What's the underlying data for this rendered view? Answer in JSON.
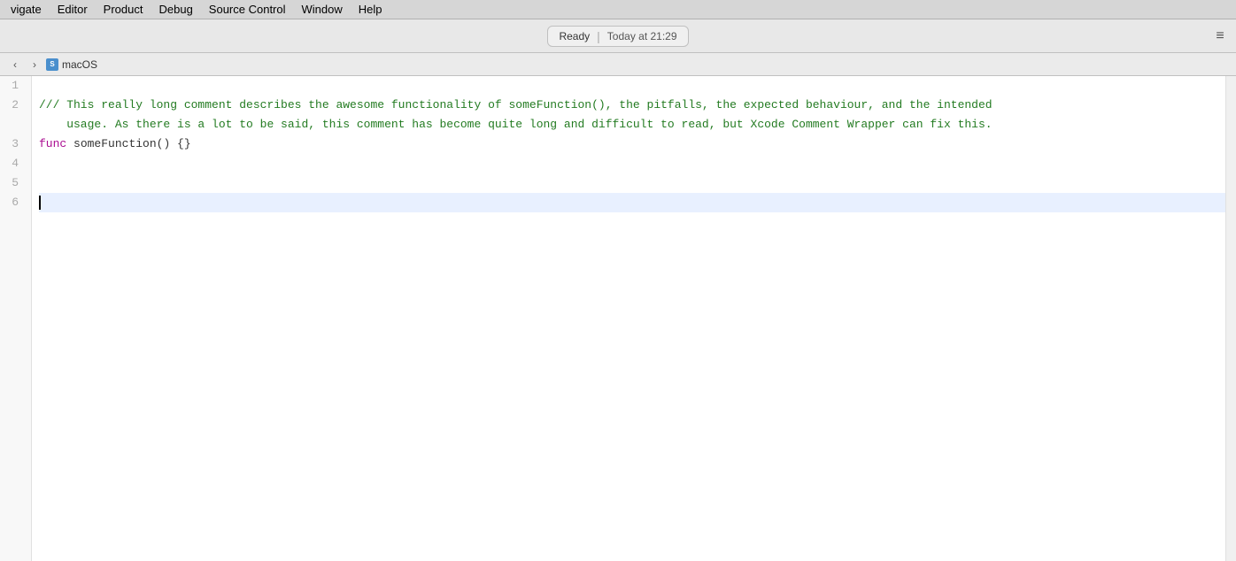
{
  "menu": {
    "items": [
      {
        "label": "vigate",
        "id": "navigate"
      },
      {
        "label": "Editor",
        "id": "editor"
      },
      {
        "label": "Product",
        "id": "product"
      },
      {
        "label": "Debug",
        "id": "debug"
      },
      {
        "label": "Source Control",
        "id": "source-control"
      },
      {
        "label": "Window",
        "id": "window"
      },
      {
        "label": "Help",
        "id": "help"
      }
    ]
  },
  "toolbar": {
    "status_ready": "Ready",
    "separator": "|",
    "timestamp": "Today at 21:29",
    "expand_icon": "≡"
  },
  "breadcrumb": {
    "file_name": "macOS"
  },
  "editor": {
    "lines": [
      {
        "number": "1",
        "content": "",
        "type": "empty"
      },
      {
        "number": "2",
        "content": "/// This really long comment describes the awesome functionality of someFunction(), the pitfalls, the expected behaviour, and the intended",
        "type": "comment"
      },
      {
        "number": "",
        "content": "    usage. As there is a lot to be said, this comment has become quite long and difficult to read, but Xcode Comment Wrapper can fix this.",
        "type": "comment-continuation"
      },
      {
        "number": "3",
        "content": "func someFunction() {}",
        "type": "code"
      },
      {
        "number": "4",
        "content": "",
        "type": "empty"
      },
      {
        "number": "5",
        "content": "",
        "type": "empty"
      },
      {
        "number": "6",
        "content": "",
        "type": "active-cursor"
      }
    ]
  }
}
